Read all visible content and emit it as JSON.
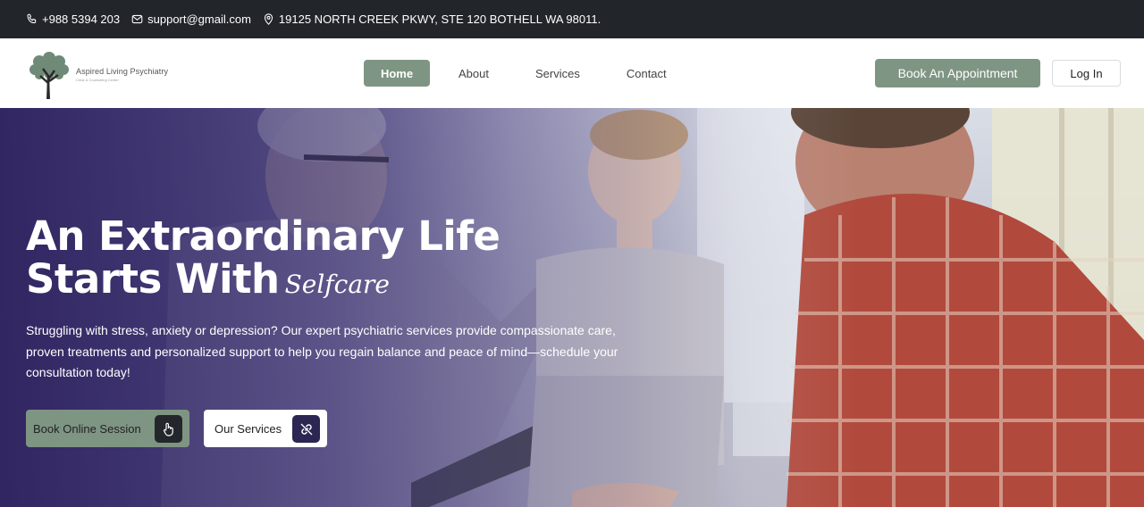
{
  "topbar": {
    "phone": "+988 5394 203",
    "email": "support@gmail.com",
    "address": "19125 NORTH CREEK PKWY, STE 120 BOTHELL WA 98011.",
    "icons": [
      "phone-icon",
      "mail-icon",
      "location-pin-icon"
    ]
  },
  "header": {
    "logo_title": "Aspired Living Psychiatry",
    "logo_subtitle": "Clinic & Counseling Center",
    "nav": {
      "home": "Home",
      "about": "About",
      "services": "Services",
      "contact": "Contact"
    },
    "active_nav": "Home",
    "book_button": "Book An Appointment",
    "login_button": "Log In"
  },
  "hero": {
    "headline_line1": "An Extraordinary Life",
    "headline_line2": "Starts With",
    "headline_accent": "Selfcare",
    "paragraph": "Struggling with stress, anxiety or depression? Our expert psychiatric services provide compassionate care, proven treatments and personalized support to help you regain balance and peace of mind—schedule your consultation today!",
    "primary_button": "Book Online Session",
    "secondary_button": "Our Services",
    "primary_button_icon": "hand-pointer-icon",
    "secondary_button_icon": "link-icon"
  },
  "colors": {
    "topbar_bg": "#22252a",
    "accent_green": "#7f9583",
    "hero_overlay": "#30245e",
    "dark_button_square": "#23272b",
    "purple_button_square": "#2c2652"
  }
}
